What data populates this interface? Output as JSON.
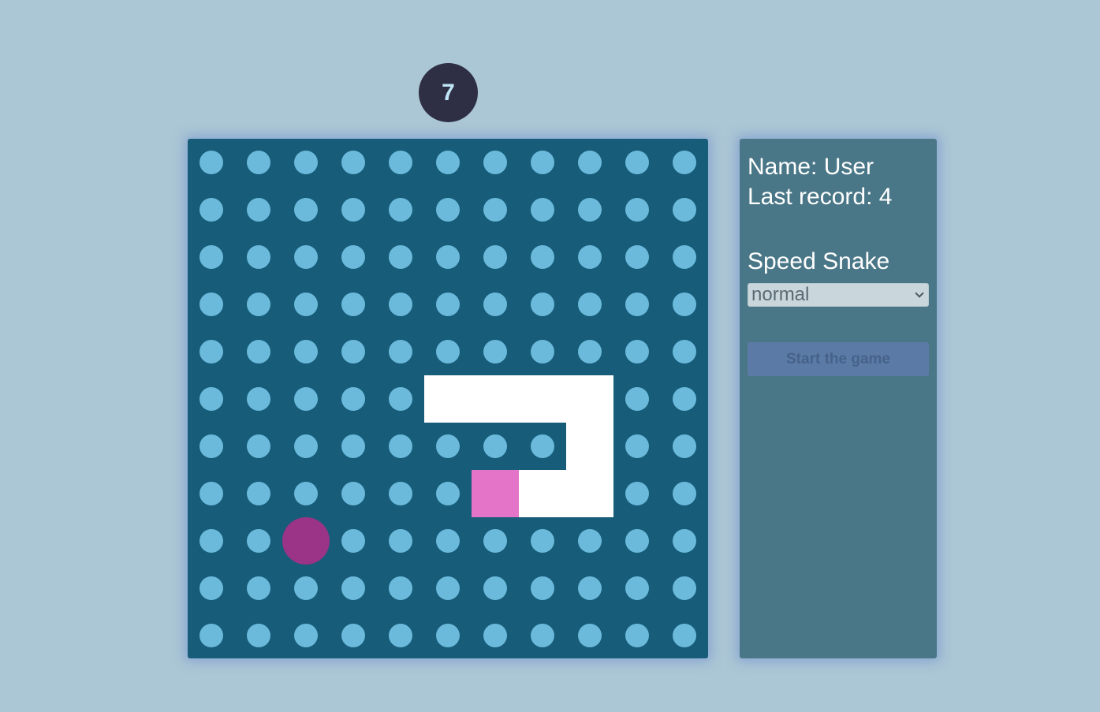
{
  "score": "7",
  "board": {
    "cols": 11,
    "rows": 11,
    "snake": [
      [
        6,
        7
      ],
      [
        7,
        7
      ],
      [
        8,
        7
      ],
      [
        8,
        6
      ],
      [
        8,
        5
      ],
      [
        7,
        5
      ],
      [
        6,
        5
      ],
      [
        5,
        5
      ]
    ],
    "head": [
      6,
      7
    ],
    "food": [
      2,
      8
    ],
    "colors": {
      "background": "#175c79",
      "dot": "#6bbadc",
      "snake": "#ffffff",
      "head": "#e474c8",
      "food": "#9b3387"
    }
  },
  "panel": {
    "name_line": "Name: User",
    "record_line": "Last record: 4",
    "speed_label": "Speed Snake",
    "speed_value": "normal",
    "start_label": "Start the game"
  }
}
